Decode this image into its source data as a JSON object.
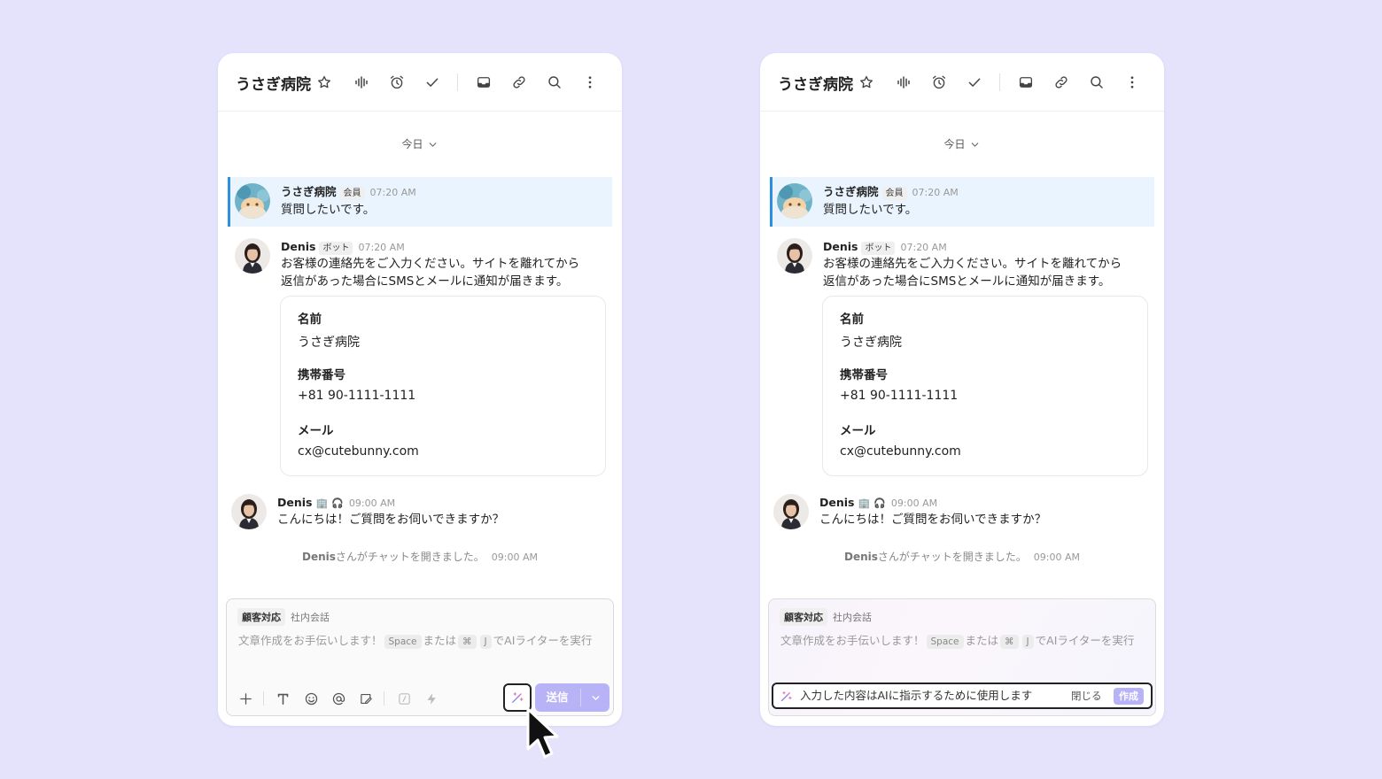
{
  "panels": [
    {
      "id": "left",
      "header": {
        "title": "うさぎ病院"
      },
      "date_separator": "今日",
      "messages": [
        {
          "name": "うさぎ病院",
          "badge": "会員",
          "time": "07:20 AM",
          "text": "質問したいです。"
        },
        {
          "name": "Denis",
          "badge": "ボット",
          "time": "07:20 AM",
          "text_line1": "お客様の連絡先をご入力ください。サイトを離れてから",
          "text_line2": "返信があった場合にSMSとメールに通知が届きます。"
        },
        {
          "name": "Denis",
          "emoji1": "🏢",
          "emoji2": "🎧",
          "time": "09:00 AM",
          "text": "こんにちは！ご質問をお伺いできますか？"
        }
      ],
      "form": {
        "name_label": "名前",
        "name_value": "うさぎ病院",
        "phone_label": "携帯番号",
        "phone_value": "+81 90-1111-1111",
        "email_label": "メール",
        "email_value": "cx@cutebunny.com"
      },
      "system_note": {
        "who": "Denis",
        "text": "さんがチャットを開きました。",
        "time": "09:00 AM"
      },
      "composer": {
        "tab_active": "顧客対応",
        "tab_other": "社内会話",
        "placeholder_a": "文章作成をお手伝いします！",
        "key_space": "Space",
        "placeholder_b": "または",
        "key_cmd": "⌘",
        "key_j": "J",
        "placeholder_c": "でAIライターを実行",
        "send_label": "送信"
      }
    },
    {
      "id": "right",
      "header": {
        "title": "うさぎ病院"
      },
      "date_separator": "今日",
      "messages": [
        {
          "name": "うさぎ病院",
          "badge": "会員",
          "time": "07:20 AM",
          "text": "質問したいです。"
        },
        {
          "name": "Denis",
          "badge": "ボット",
          "time": "07:20 AM",
          "text_line1": "お客様の連絡先をご入力ください。サイトを離れてから",
          "text_line2": "返信があった場合にSMSとメールに通知が届きます。"
        },
        {
          "name": "Denis",
          "emoji1": "🏢",
          "emoji2": "🎧",
          "time": "09:00 AM",
          "text": "こんにちは！ご質問をお伺いできますか？"
        }
      ],
      "form": {
        "name_label": "名前",
        "name_value": "うさぎ病院",
        "phone_label": "携帯番号",
        "phone_value": "+81 90-1111-1111",
        "email_label": "メール",
        "email_value": "cx@cutebunny.com"
      },
      "system_note": {
        "who": "Denis",
        "text": "さんがチャットを開きました。",
        "time": "09:00 AM"
      },
      "composer": {
        "tab_active": "顧客対応",
        "tab_other": "社内会話",
        "placeholder_a": "文章作成をお手伝いします！",
        "key_space": "Space",
        "placeholder_b": "または",
        "key_cmd": "⌘",
        "key_j": "J",
        "placeholder_c": "でAIライターを実行",
        "ai_prompt": "入力した内容はAIに指示するために使用します",
        "ai_close": "閉じる",
        "ai_create": "作成"
      }
    }
  ],
  "colors": {
    "background": "#e4e3fb",
    "highlight": "#eaf4fe",
    "highlight_border": "#2e8fe0",
    "accent": "#b7b3f6"
  },
  "icons": [
    "star-icon",
    "voice-icon",
    "alarm-icon",
    "check-icon",
    "inbox-icon",
    "link-icon",
    "search-icon",
    "more-icon",
    "chevron-down-icon",
    "plus-icon",
    "text-format-icon",
    "emoji-icon",
    "mention-icon",
    "snippet-icon",
    "command-icon",
    "bolt-icon",
    "ai-sparkle-icon",
    "cursor-icon"
  ]
}
